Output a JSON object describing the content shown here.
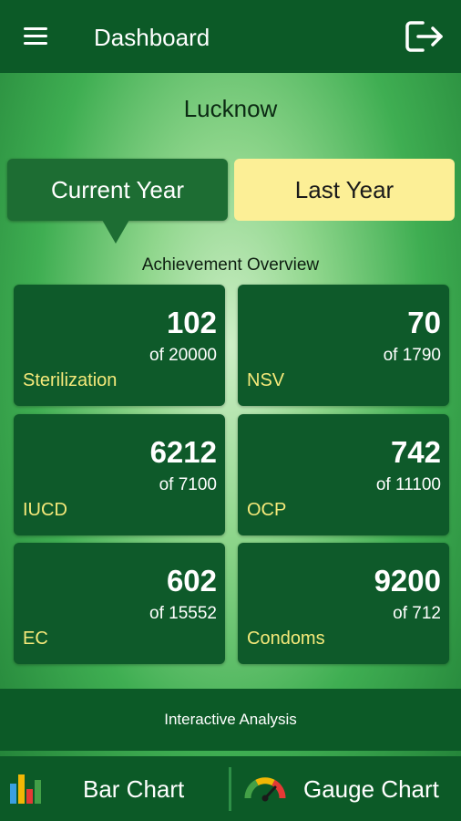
{
  "app_bar": {
    "title": "Dashboard",
    "menu_icon": "hamburger-menu-icon",
    "logout_icon": "logout-icon"
  },
  "location": "Lucknow",
  "tabs": {
    "current": "Current Year",
    "last": "Last Year",
    "selected": "current"
  },
  "overview": {
    "title": "Achievement Overview",
    "cards": [
      {
        "value": "102",
        "target": "of 20000",
        "name": "Sterilization"
      },
      {
        "value": "70",
        "target": "of 1790",
        "name": "NSV"
      },
      {
        "value": "6212",
        "target": "of 7100",
        "name": "IUCD"
      },
      {
        "value": "742",
        "target": "of 11100",
        "name": "OCP"
      },
      {
        "value": "602",
        "target": "of 15552",
        "name": "EC"
      },
      {
        "value": "9200",
        "target": "of 712",
        "name": "Condoms"
      }
    ]
  },
  "interactive_analysis": "Interactive Analysis",
  "bottom_nav": {
    "bar_chart": "Bar Chart",
    "gauge_chart": "Gauge Chart"
  },
  "colors": {
    "header": "#0c5a27",
    "card": "#0e5a2a",
    "card_label": "#f5e97a",
    "tab_selected": "#1d6d33",
    "tab_unselected": "#fcef96"
  }
}
